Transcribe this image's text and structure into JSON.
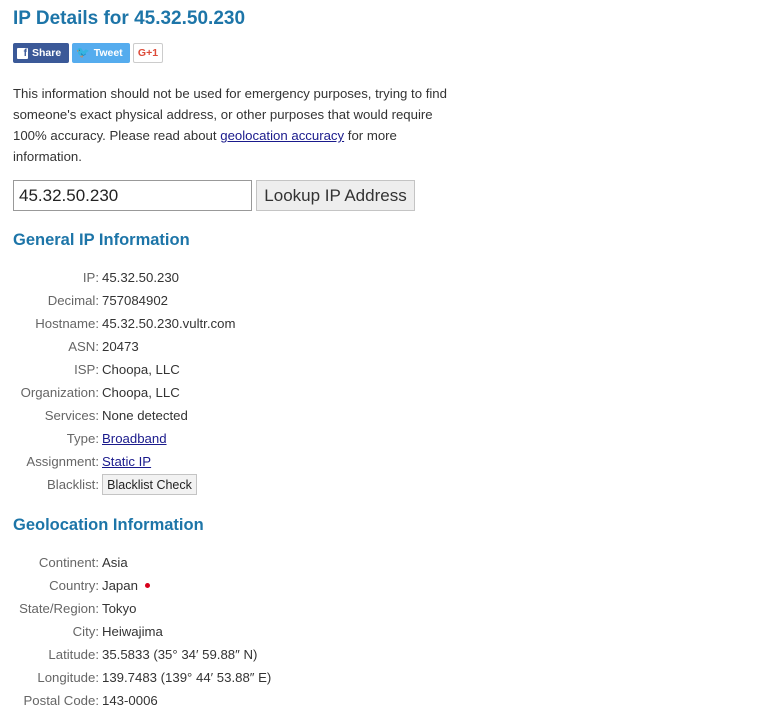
{
  "page": {
    "title": "IP Details for 45.32.50.230"
  },
  "share": {
    "facebook_label": "Share",
    "facebook_glyph": "f",
    "twitter_label": "Tweet",
    "twitter_glyph": "🐦",
    "google_label": "G+1"
  },
  "disclaimer": {
    "before_link": "This information should not be used for emergency purposes, trying to find someone's exact physical address, or other purposes that would require 100% accuracy. Please read about ",
    "link_text": "geolocation accuracy",
    "after_link": " for more information."
  },
  "lookup": {
    "input_value": "45.32.50.230",
    "button_label": "Lookup IP Address"
  },
  "general": {
    "heading": "General IP Information",
    "rows": [
      {
        "label": "IP:",
        "value": "45.32.50.230"
      },
      {
        "label": "Decimal:",
        "value": "757084902"
      },
      {
        "label": "Hostname:",
        "value": "45.32.50.230.vultr.com"
      },
      {
        "label": "ASN:",
        "value": "20473"
      },
      {
        "label": "ISP:",
        "value": "Choopa, LLC"
      },
      {
        "label": "Organization:",
        "value": "Choopa, LLC"
      },
      {
        "label": "Services:",
        "value": "None detected"
      },
      {
        "label": "Type:",
        "value": "Broadband"
      },
      {
        "label": "Assignment:",
        "value": "Static IP"
      },
      {
        "label": "Blacklist:",
        "value": "Blacklist Check"
      }
    ]
  },
  "geo": {
    "heading": "Geolocation Information",
    "rows": [
      {
        "label": "Continent:",
        "value": "Asia"
      },
      {
        "label": "Country:",
        "value": "Japan",
        "flag_color": "#d7001b"
      },
      {
        "label": "State/Region:",
        "value": "Tokyo"
      },
      {
        "label": "City:",
        "value": "Heiwajima"
      },
      {
        "label": "Latitude:",
        "value": "35.5833  (35° 34′ 59.88″ N)"
      },
      {
        "label": "Longitude:",
        "value": "139.7483  (139° 44′ 53.88″ E)"
      },
      {
        "label": "Postal Code:",
        "value": "143-0006"
      }
    ]
  },
  "colors": {
    "heading": "#1d75a8",
    "link": "#1a1a8c",
    "facebook": "#3b5998",
    "twitter": "#55acee",
    "google": "#dd4b39"
  }
}
